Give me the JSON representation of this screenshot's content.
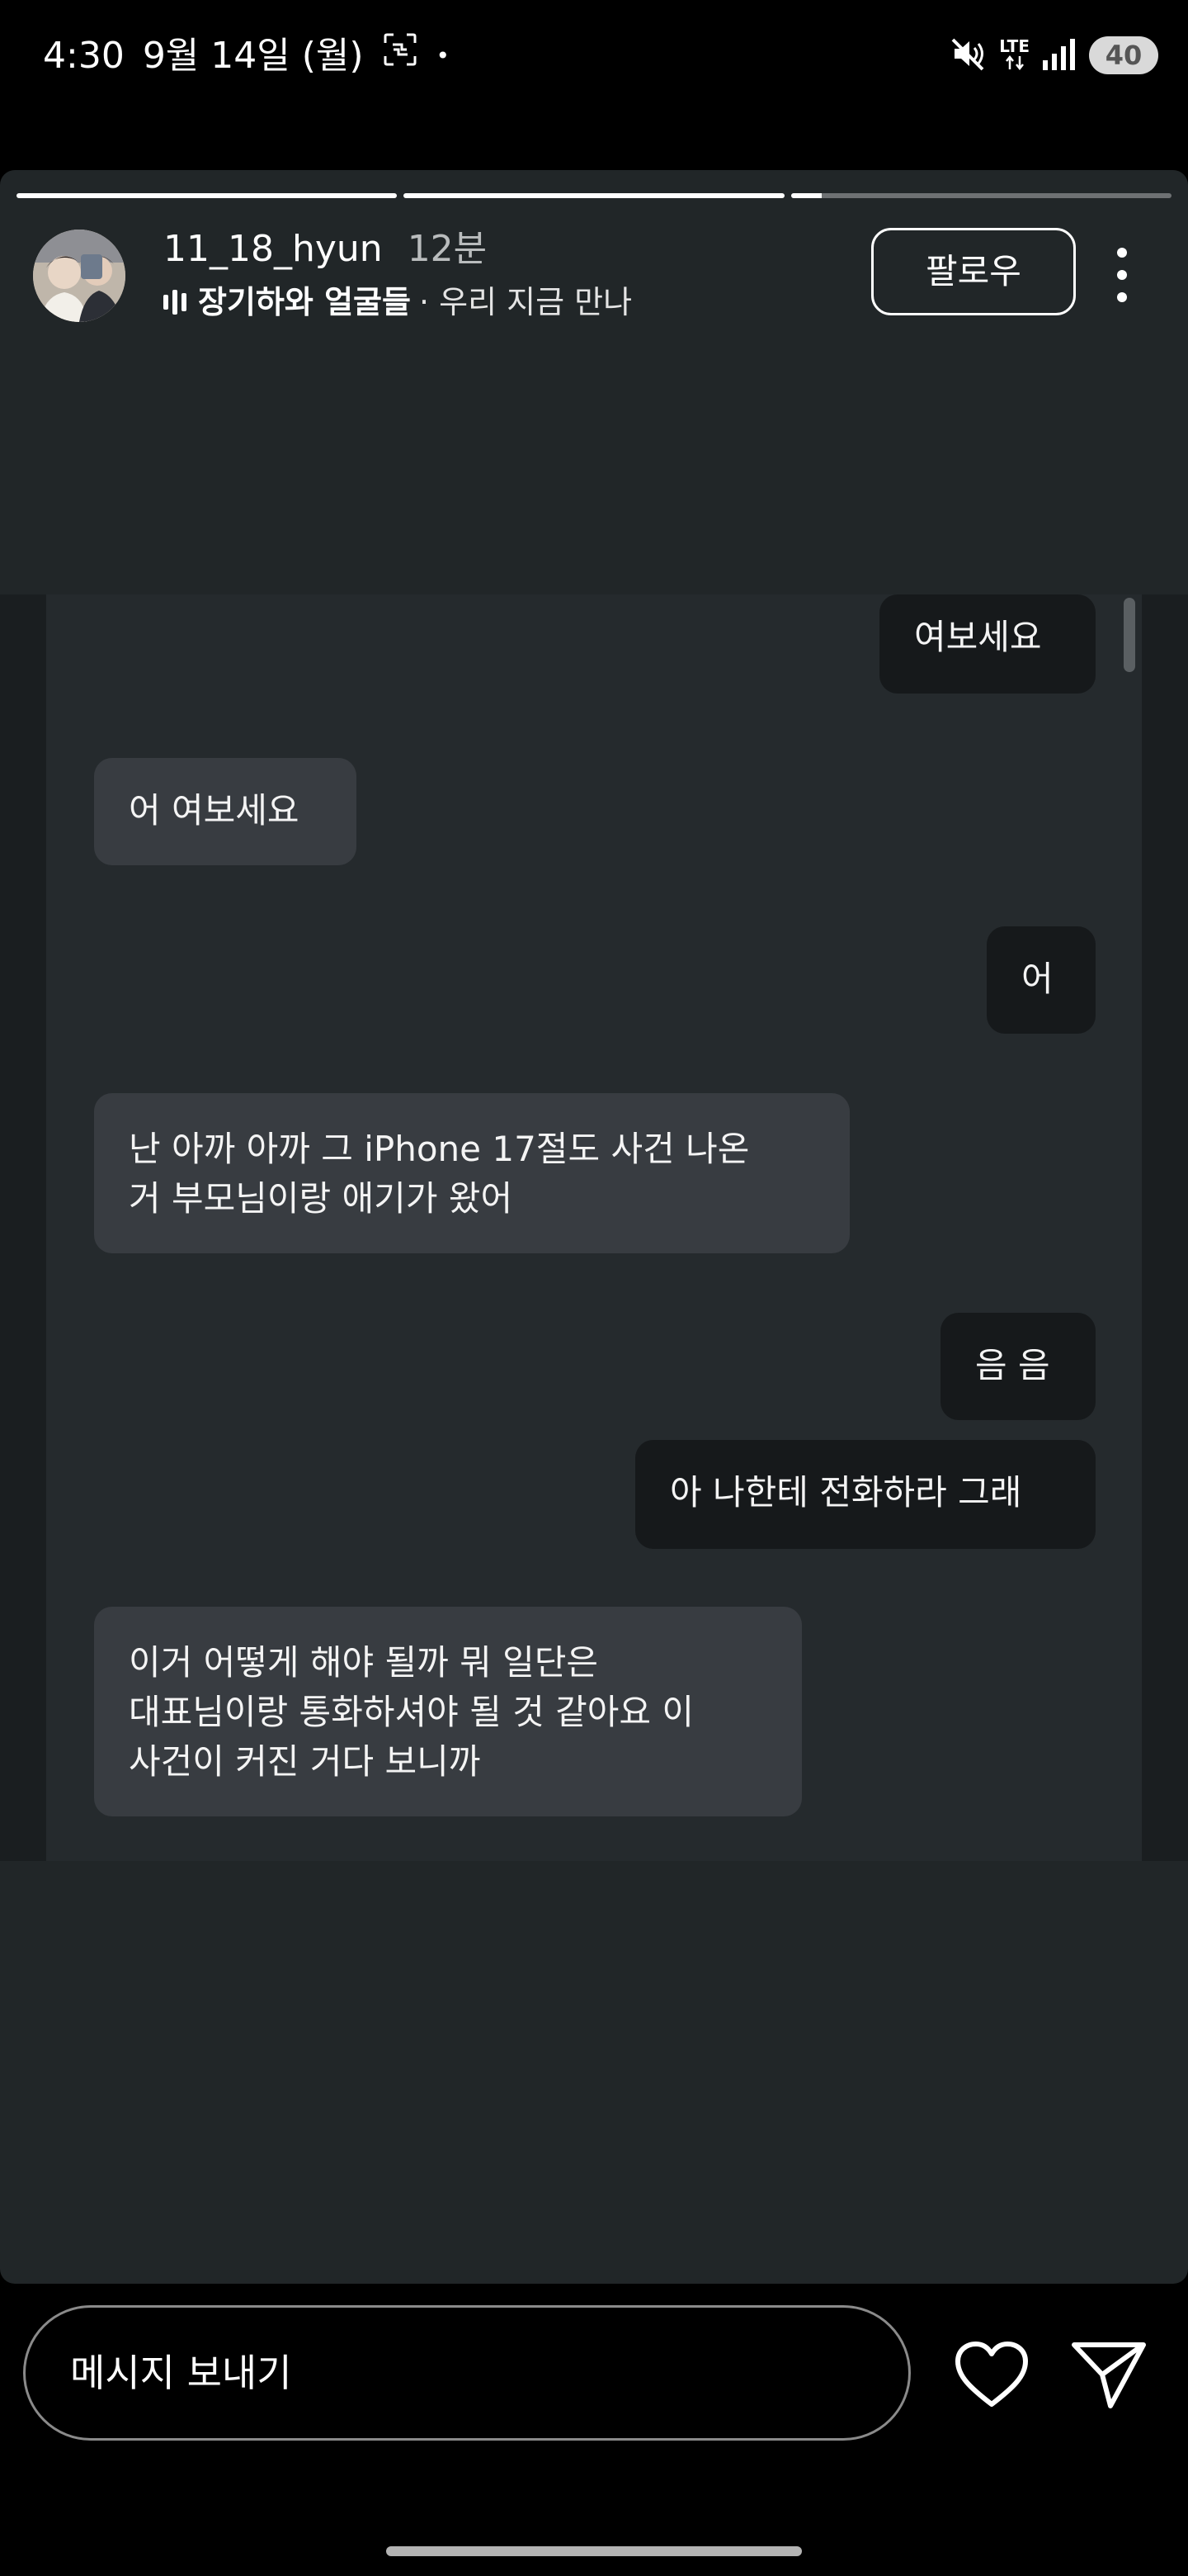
{
  "status_bar": {
    "time": "4:30",
    "date": "9월 14일 (월)",
    "notification_dot": "•",
    "network": "LTE",
    "battery": "40",
    "icons": [
      "screenshot-icon",
      "mute-icon",
      "lte-icon",
      "signal-icon",
      "battery-icon"
    ]
  },
  "story": {
    "progress": [
      1.0,
      1.0,
      0.08
    ],
    "username": "11_18_hyun",
    "time_ago": "12분",
    "song_title": "장기하와 얼굴들",
    "song_artist": "· 우리 지금 만나",
    "follow_label": "팔로우",
    "background_color": "#212628"
  },
  "chat": {
    "messages": [
      {
        "side": "me",
        "text": "여보세요"
      },
      {
        "side": "them",
        "text": "어 여보세요"
      },
      {
        "side": "me",
        "text": "어"
      },
      {
        "side": "them",
        "text": "난 아까 아까 그 iPhone 17절도 사건 나온\n거 부모님이랑 애기가 왔어"
      },
      {
        "side": "me",
        "text": "음 음"
      },
      {
        "side": "me",
        "text": "아 나한테 전화하라 그래"
      },
      {
        "side": "them",
        "text": "이거 어떻게 해야 될까 뭐 일단은\n대표님이랑 통화하셔야 될 것 같아요 이\n사건이 커진 거다 보니까"
      }
    ]
  },
  "bottom_bar": {
    "message_placeholder": "메시지 보내기",
    "icons": [
      "heart-icon",
      "send-icon"
    ]
  }
}
